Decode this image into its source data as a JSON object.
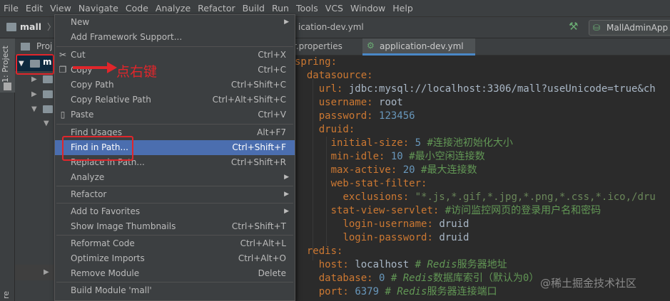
{
  "menubar": [
    "File",
    "Edit",
    "View",
    "Navigate",
    "Code",
    "Analyze",
    "Refactor",
    "Build",
    "Run",
    "Tools",
    "VCS",
    "Window",
    "Help"
  ],
  "breadcrumb": {
    "project": "mall",
    "file_partial": "ication-dev.yml"
  },
  "run_config": "MallAdminApp",
  "left_strip_label": "1: Project",
  "left_strip_bottom": "re",
  "project_panel": {
    "title_partial": "Proj",
    "root_partial": "m"
  },
  "editor_tabs": [
    {
      "label": "r.properties"
    },
    {
      "label": "application-dev.yml"
    }
  ],
  "annotation": "点右键",
  "watermark": "@稀土掘金技术社区",
  "context_menu": {
    "items": [
      {
        "label": "New",
        "shortcut": "",
        "submenu": true
      },
      {
        "label": "Add Framework Support...",
        "shortcut": ""
      },
      {
        "label": "Cut",
        "shortcut": "Ctrl+X",
        "icon": "cut-icon"
      },
      {
        "label": "Copy",
        "shortcut": "Ctrl+C",
        "icon": "copy-icon"
      },
      {
        "label": "Copy Path",
        "shortcut": "Ctrl+Shift+C"
      },
      {
        "label": "Copy Relative Path",
        "shortcut": "Ctrl+Alt+Shift+C"
      },
      {
        "label": "Paste",
        "shortcut": "Ctrl+V",
        "icon": "paste-icon"
      },
      {
        "label": "Find Usages",
        "shortcut": "Alt+F7"
      },
      {
        "label": "Find in Path...",
        "shortcut": "Ctrl+Shift+F",
        "selected": true
      },
      {
        "label": "Replace in Path...",
        "shortcut": "Ctrl+Shift+R"
      },
      {
        "label": "Analyze",
        "shortcut": "",
        "submenu": true
      },
      {
        "label": "Refactor",
        "shortcut": "",
        "submenu": true
      },
      {
        "label": "Add to Favorites",
        "shortcut": "",
        "submenu": true
      },
      {
        "label": "Show Image Thumbnails",
        "shortcut": "Ctrl+Shift+T"
      },
      {
        "label": "Reformat Code",
        "shortcut": "Ctrl+Alt+L"
      },
      {
        "label": "Optimize Imports",
        "shortcut": "Ctrl+Alt+O"
      },
      {
        "label": "Remove Module",
        "shortcut": "Delete"
      },
      {
        "label": "Build Module 'mall'",
        "shortcut": ""
      }
    ]
  },
  "code_lines": [
    "spring:",
    "  datasource:",
    "    url: jdbc:mysql://localhost:3306/mall?useUnicode=true&ch",
    "    username: root",
    "    password: 123456",
    "    druid:",
    "      initial-size: 5 #连接池初始化大小",
    "      min-idle: 10 #最小空闲连接数",
    "      max-active: 20 #最大连接数",
    "      web-stat-filter:",
    "        exclusions: \"*.js,*.gif,*.jpg,*.png,*.css,*.ico,/dru",
    "      stat-view-servlet: #访问监控网页的登录用户名和密码",
    "        login-username: druid",
    "        login-password: druid",
    "  redis:",
    "    host: localhost # Redis服务器地址",
    "    database: 0 # Redis数据库索引（默认为0）",
    "    port: 6379 # Redis服务器连接端口"
  ]
}
